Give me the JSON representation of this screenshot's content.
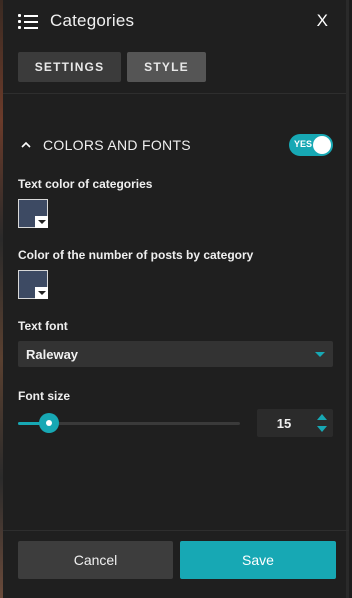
{
  "header": {
    "title": "Categories",
    "close_label": "X"
  },
  "tabs": [
    {
      "label": "SETTINGS"
    },
    {
      "label": "STYLE"
    }
  ],
  "section": {
    "title": "COLORS AND FONTS",
    "toggle_label": "YES"
  },
  "fields": {
    "text_color": {
      "label": "Text color of categories",
      "color": "#3d4a63"
    },
    "count_color": {
      "label": "Color of the number of posts by category",
      "color": "#3d4a63"
    },
    "text_font": {
      "label": "Text font",
      "value": "Raleway"
    },
    "font_size": {
      "label": "Font size",
      "value": "15",
      "slider_fraction": 0.14
    }
  },
  "footer": {
    "cancel_label": "Cancel",
    "save_label": "Save"
  },
  "colors": {
    "accent": "#17a8b4",
    "panel": "#1f1f1f",
    "control": "#333333"
  },
  "icons": [
    "list-menu-icon",
    "close-icon",
    "chevron-up-icon",
    "dropdown-caret-icon",
    "stepper-arrows-icon"
  ]
}
